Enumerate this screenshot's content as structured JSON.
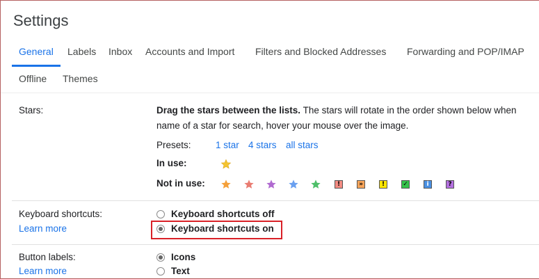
{
  "page_title": "Settings",
  "tabs": [
    {
      "label": "General"
    },
    {
      "label": "Labels"
    },
    {
      "label": "Inbox"
    },
    {
      "label": "Accounts and Import"
    },
    {
      "label": "Filters and Blocked Addresses"
    },
    {
      "label": "Forwarding and POP/IMAP"
    },
    {
      "label": "Offline"
    },
    {
      "label": "Themes"
    }
  ],
  "stars": {
    "label": "Stars:",
    "instruction_bold": "Drag the stars between the lists.",
    "instruction_rest": "The stars will rotate in the order shown below when",
    "instruction_line2": "name of a star for search, hover your mouse over the image.",
    "presets_label": "Presets:",
    "presets": [
      "1 star",
      "4 stars",
      "all stars"
    ],
    "in_use_label": "In use:",
    "not_in_use_label": "Not in use:",
    "in_use_icons": [
      {
        "name": "yellow-star",
        "color": "#f4c430"
      }
    ],
    "not_in_use_stars": [
      {
        "name": "orange-star",
        "color": "#f4a03a"
      },
      {
        "name": "red-star",
        "color": "#e97c72"
      },
      {
        "name": "purple-star",
        "color": "#b06ad0"
      },
      {
        "name": "blue-star",
        "color": "#6aa0f0"
      },
      {
        "name": "green-star",
        "color": "#4fbf6a"
      }
    ],
    "not_in_use_boxes": [
      {
        "name": "red-bang",
        "glyph": "!",
        "bg": "#f28b82",
        "fg": "#000000"
      },
      {
        "name": "orange-guillemet",
        "glyph": "»",
        "bg": "#f6a45a",
        "fg": "#000000"
      },
      {
        "name": "yellow-bang",
        "glyph": "!",
        "bg": "#ffe600",
        "fg": "#000000"
      },
      {
        "name": "green-check",
        "glyph": "✓",
        "bg": "#34c24a",
        "fg": "#000000"
      },
      {
        "name": "blue-info",
        "glyph": "i",
        "bg": "#4a90e2",
        "fg": "#ffffff"
      },
      {
        "name": "purple-question",
        "glyph": "?",
        "bg": "#b470e0",
        "fg": "#000000"
      }
    ]
  },
  "keyboard_shortcuts": {
    "label": "Keyboard shortcuts:",
    "learn_more": "Learn more",
    "options": [
      {
        "label": "Keyboard shortcuts off",
        "checked": false
      },
      {
        "label": "Keyboard shortcuts on",
        "checked": true
      }
    ],
    "highlight_color": "#d92027"
  },
  "button_labels": {
    "label": "Button labels:",
    "learn_more": "Learn more",
    "options": [
      {
        "label": "Icons",
        "checked": true
      },
      {
        "label": "Text",
        "checked": false
      }
    ]
  },
  "colors": {
    "accent": "#1a73e8",
    "text": "#202124"
  }
}
